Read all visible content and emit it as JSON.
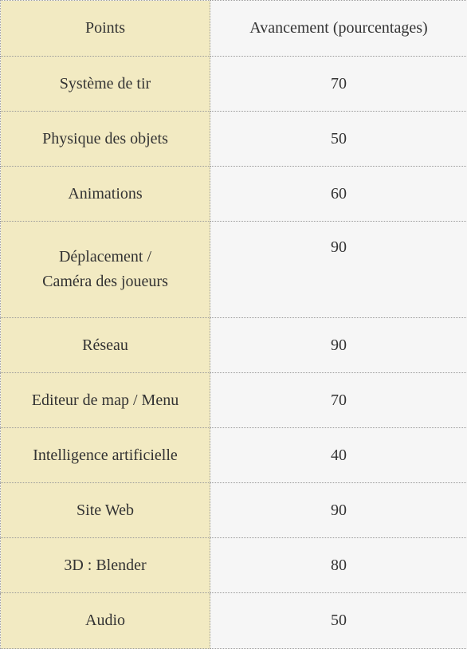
{
  "table": {
    "headers": {
      "points": "Points",
      "progress": "Avancement (pourcentages)"
    },
    "rows": [
      {
        "point": "Système de tir",
        "value": "70"
      },
      {
        "point": "Physique des objets",
        "value": "50"
      },
      {
        "point": "Animations",
        "value": "60"
      },
      {
        "point": "Déplacement / Caméra des joueurs",
        "point_lines": [
          "Déplacement /",
          "Caméra des joueurs"
        ],
        "value": "90"
      },
      {
        "point": "Réseau",
        "value": "90"
      },
      {
        "point": "Editeur de map / Menu",
        "value": "70"
      },
      {
        "point": "Intelligence artificielle",
        "value": "40"
      },
      {
        "point": "Site Web",
        "value": "90"
      },
      {
        "point": "3D : Blender",
        "value": "80"
      },
      {
        "point": "Audio",
        "value": "50"
      }
    ]
  },
  "colors": {
    "points_column_bg": "#f2eac2",
    "values_column_bg": "#f6f6f6",
    "border": "#9a9a9a",
    "text": "#333333"
  }
}
